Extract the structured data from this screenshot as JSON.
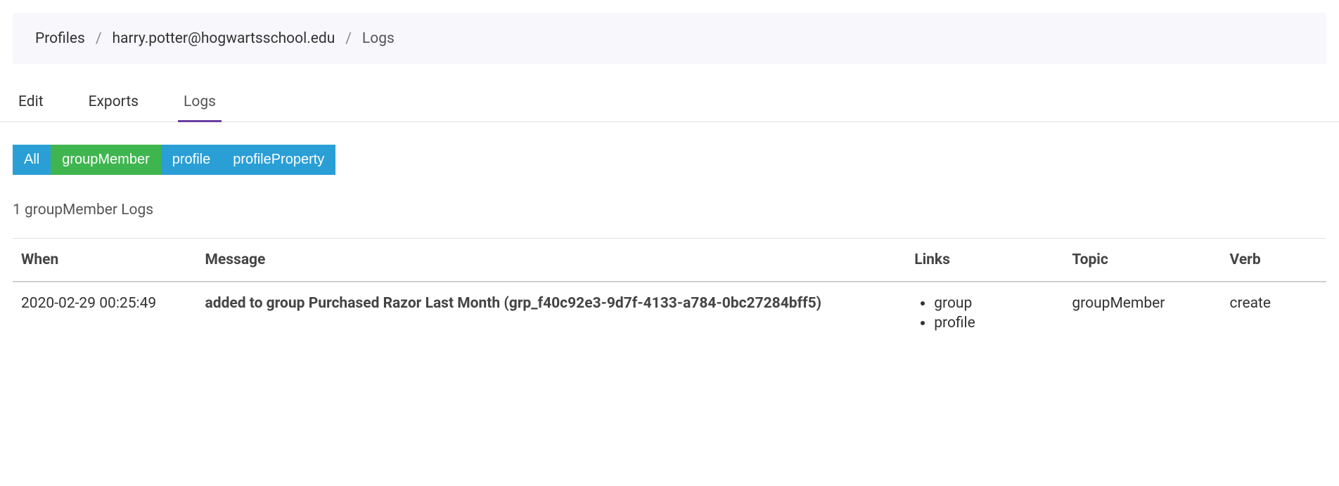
{
  "breadcrumb": {
    "items": [
      {
        "label": "Profiles"
      },
      {
        "label": "harry.potter@hogwartsschool.edu"
      },
      {
        "label": "Logs"
      }
    ],
    "separator": "/"
  },
  "tabs": [
    {
      "label": "Edit",
      "active": false
    },
    {
      "label": "Exports",
      "active": false
    },
    {
      "label": "Logs",
      "active": true
    }
  ],
  "filters": [
    {
      "label": "All",
      "color": "blue"
    },
    {
      "label": "groupMember",
      "color": "green"
    },
    {
      "label": "profile",
      "color": "blue"
    },
    {
      "label": "profileProperty",
      "color": "blue"
    }
  ],
  "logs_count": "1 groupMember Logs",
  "table": {
    "headers": {
      "when": "When",
      "message": "Message",
      "links": "Links",
      "topic": "Topic",
      "verb": "Verb"
    },
    "rows": [
      {
        "when": "2020-02-29 00:25:49",
        "message": "added to group Purchased Razor Last Month (grp_f40c92e3-9d7f-4133-a784-0bc27284bff5)",
        "links": [
          "group",
          "profile"
        ],
        "topic": "groupMember",
        "verb": "create"
      }
    ]
  }
}
